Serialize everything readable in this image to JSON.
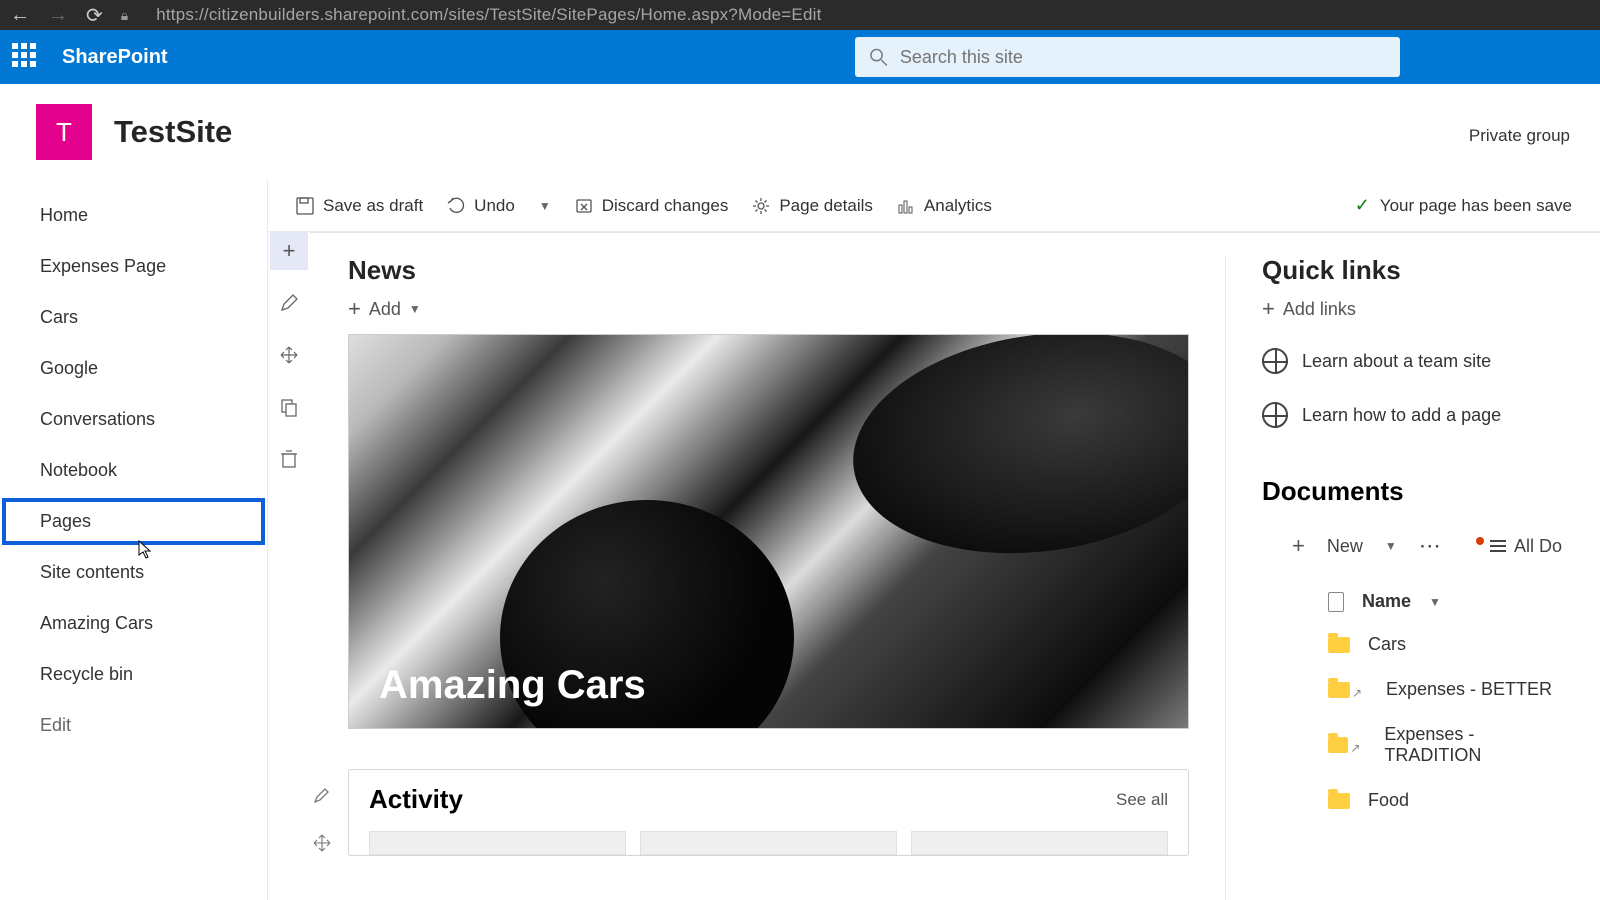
{
  "browser": {
    "url": "https://citizenbuilders.sharepoint.com/sites/TestSite/SitePages/Home.aspx?Mode=Edit"
  },
  "suite": {
    "app_name": "SharePoint",
    "search_placeholder": "Search this site"
  },
  "site": {
    "logo_letter": "T",
    "name": "TestSite",
    "group_type": "Private group"
  },
  "leftnav": {
    "items": [
      "Home",
      "Expenses Page",
      "Cars",
      "Google",
      "Conversations",
      "Notebook",
      "Pages",
      "Site contents",
      "Amazing Cars",
      "Recycle bin"
    ],
    "edit": "Edit"
  },
  "commands": {
    "save_draft": "Save as draft",
    "undo": "Undo",
    "discard": "Discard changes",
    "page_details": "Page details",
    "analytics": "Analytics",
    "status": "Your page has been save"
  },
  "news": {
    "title": "News",
    "add": "Add",
    "hero_title": "Amazing Cars"
  },
  "activity": {
    "title": "Activity",
    "see_all": "See all"
  },
  "quicklinks": {
    "title": "Quick links",
    "add": "Add links",
    "items": [
      "Learn about a team site",
      "Learn how to add a page"
    ]
  },
  "documents": {
    "title": "Documents",
    "new": "New",
    "view": "All Do",
    "col_name": "Name",
    "rows": [
      {
        "name": "Cars",
        "type": "folder"
      },
      {
        "name": "Expenses - BETTER",
        "type": "folder",
        "link": true
      },
      {
        "name": "Expenses - TRADITION",
        "type": "folder",
        "link": true
      },
      {
        "name": "Food",
        "type": "folder"
      }
    ]
  }
}
